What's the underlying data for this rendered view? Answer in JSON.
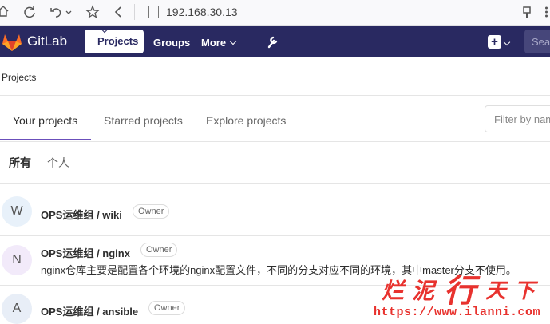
{
  "browser": {
    "url": "192.168.30.13",
    "icons": [
      "home-icon",
      "refresh-icon",
      "undo-icon",
      "chevron-down-icon",
      "star-icon",
      "back-icon",
      "page-icon",
      "extension-icon",
      "menu-icon"
    ]
  },
  "navbar": {
    "brand": "GitLab",
    "items": [
      "Projects",
      "Groups",
      "More"
    ],
    "search_placeholder": "Sea",
    "icons": [
      "gitlab-logo-icon",
      "wrench-icon",
      "plus-icon",
      "chevron-down-icon"
    ]
  },
  "breadcrumb": "Projects",
  "tabs": [
    "Your projects",
    "Starred projects",
    "Explore projects"
  ],
  "filter_placeholder": "Filter by nam",
  "subtabs": [
    "所有",
    "个人"
  ],
  "projects": [
    {
      "avatar": "W",
      "name": "OPS运维组 / wiki",
      "badge": "Owner",
      "avatar_color": "#e8f1fa"
    },
    {
      "avatar": "N",
      "name": "OPS运维组 / nginx",
      "badge": "Owner",
      "desc": "nginx仓库主要是配置各个环境的nginx配置文件，不同的分支对应不同的环境，其中master分支不使用。",
      "avatar_color": "#f2eafa"
    },
    {
      "avatar": "A",
      "name": "OPS运维组 / ansible",
      "badge": "Owner",
      "avatar_color": "#e8eef7"
    }
  ],
  "watermark": {
    "chars": [
      "烂",
      "泥",
      "行",
      "天",
      "下"
    ],
    "url": "https://www.ilanni.com"
  },
  "colors": {
    "navbar": "#292961",
    "accent": "#6b4fbb",
    "watermark": "#e8322e"
  }
}
